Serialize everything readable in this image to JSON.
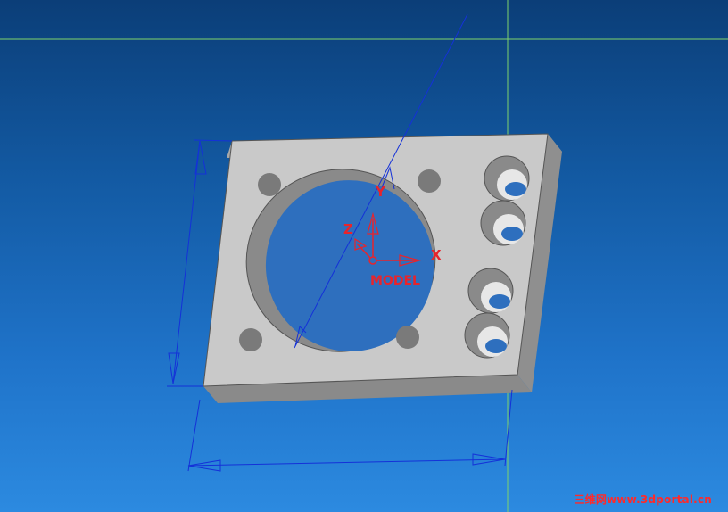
{
  "viewport": {
    "background_top": "#0b3e78",
    "background_bottom": "#2c8ae0",
    "datum_line_color": "#7fd36b",
    "dimension_color": "#1431d8",
    "csys_color": "#e8242c"
  },
  "coordinate_system": {
    "x_label": "X",
    "y_label": "Y",
    "z_label": "Z",
    "caption": "MODEL"
  },
  "part": {
    "face_color": "#c9c9c9",
    "side_color": "#8f8f8f",
    "hole_inner_color": "#7e7e7e",
    "through_color": "#2c6fbf"
  },
  "watermark": {
    "text": "三维网www.3dportal.cn"
  }
}
